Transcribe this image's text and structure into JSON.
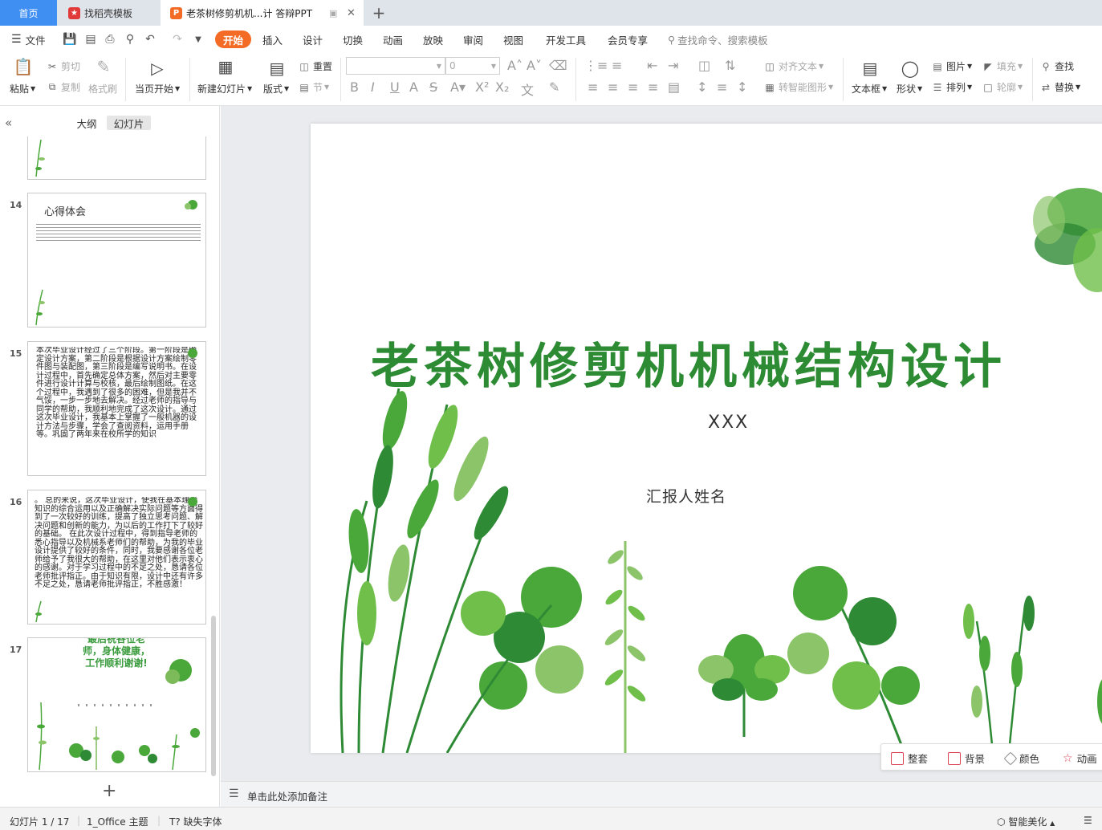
{
  "tabs": {
    "home": "首页",
    "template": "找稻壳模板",
    "document": "老茶树修剪机机...计 答辩PPT",
    "add": "+"
  },
  "menu": {
    "file": "文件",
    "items": [
      "开始",
      "插入",
      "设计",
      "切换",
      "动画",
      "放映",
      "审阅",
      "视图",
      "开发工具",
      "会员专享"
    ],
    "search_placeholder": "查找命令、搜索模板"
  },
  "ribbon": {
    "paste": "粘贴",
    "cut": "剪切",
    "copy": "复制",
    "format_painter": "格式刷",
    "start_from_current": "当页开始",
    "new_slide": "新建幻灯片",
    "layout": "版式",
    "reset": "重置",
    "section": "节",
    "font_size_value": "0",
    "align_text": "对齐文本",
    "smart_shape": "转智能图形",
    "text_box": "文本框",
    "shape": "形状",
    "picture": "图片",
    "arrange": "排列",
    "fill": "填充",
    "outline": "轮廓",
    "find": "查找",
    "replace": "替换"
  },
  "left_pane": {
    "outline_tab": "大纲",
    "slides_tab": "幻灯片",
    "thumbs": [
      {
        "num": "14",
        "title": "心得体会"
      },
      {
        "num": "15",
        "text": "本次毕业设计经过了三个阶段。第一阶段是确定设计方案，第二阶段是根据设计方案绘制零件图与装配图，第三阶段是编写说明书。在设计过程中，首先确定总体方案，然后对主要零件进行设计计算与校核，最后绘制图纸。在这个过程中，我遇到了很多的困难，但是我并不气馁，一步一步地去解决。经过老师的指导与同学的帮助，我顺利地完成了这次设计。通过这次毕业设计，我基本上掌握了一般机器的设计方法与步骤，学会了查阅资料，运用手册等。巩固了两年来在校所学的知识"
      },
      {
        "num": "16",
        "text": "。 总的来说，这次毕业设计，使我在基本理论知识的综合运用以及正确解决实际问题等方面得到了一次较好的训练，提高了独立思考问题、解决问题和创新的能力，为以后的工作打下了较好的基础。 在此次设计过程中，得到指导老师的悉心指导以及机械系老师们的帮助，为我的毕业设计提供了较好的条件，同时，我要感谢各位老师给予了我很大的帮助，在这里对他们表示衷心的感谢。对于学习过程中的不足之处，恳请各位老师批评指正。由于知识有限，设计中还有许多不足之处，恳请老师批评指正，不胜感激！"
      },
      {
        "num": "17",
        "text": "最后祝各位老师，身体健康，工作顺利谢谢!"
      }
    ]
  },
  "slide": {
    "title": "老茶树修剪机机械结构设计",
    "subtitle": "XXX",
    "reporter": "汇报人姓名"
  },
  "float_bar": {
    "items": [
      "整套",
      "背景",
      "颜色",
      "动画"
    ]
  },
  "notes": {
    "placeholder": "单击此处添加备注"
  },
  "status": {
    "slide_counter": "幻灯片 1 / 17",
    "theme": "1_Office 主题",
    "missing_font": "缺失字体",
    "beautify": "智能美化"
  },
  "colors": {
    "home_tab": "#3f8ef2",
    "active_menu": "#f36b24",
    "title_green": "#2c8b33",
    "leaf_green": "#4aa83a"
  }
}
